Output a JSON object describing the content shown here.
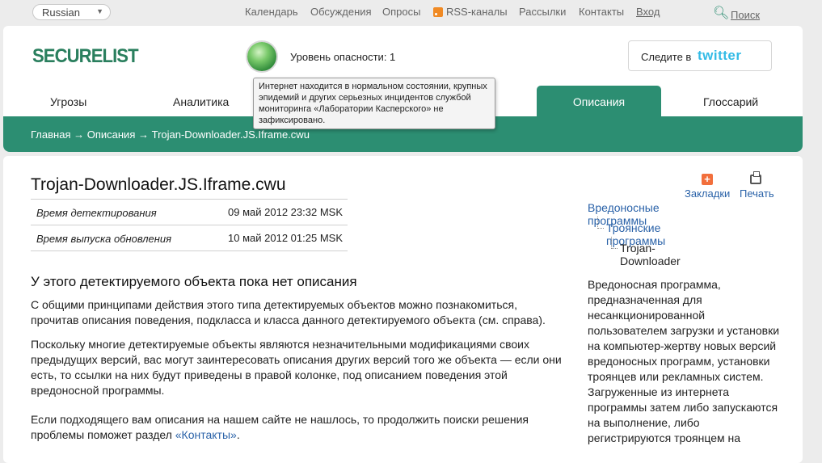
{
  "topbar": {
    "language": "Russian",
    "links": [
      "Календарь",
      "Обсуждения",
      "Опросы",
      "RSS-каналы",
      "Рассылки",
      "Контакты",
      "Вход"
    ],
    "search_label": "Поиск"
  },
  "header": {
    "logo": "SECURELIST",
    "threat_level_label": "Уровень опасности: 1",
    "twitter_prefix": "Следите в",
    "twitter_brand": "twitter",
    "tooltip": "Интернет находится в нормальном состоянии, крупных эпидемий и других серьезных инцидентов службой мониторинга «Лаборатории Касперского» не зафиксировано."
  },
  "nav": {
    "tabs": [
      "Угрозы",
      "Аналитика",
      "Описания",
      "Глоссарий"
    ],
    "active": "Описания"
  },
  "breadcrumb": {
    "home": "Главная",
    "section": "Описания",
    "current": "Trojan-Downloader.JS.Iframe.cwu",
    "separator": "→"
  },
  "main": {
    "title": "Trojan-Downloader.JS.Iframe.cwu",
    "details": [
      {
        "key": "Время детектирования",
        "value": "09 май 2012 23:32 MSK"
      },
      {
        "key": "Время выпуска обновления",
        "value": "10 май 2012 01:25 MSK"
      }
    ],
    "heading": "У этого детектируемого объекта пока нет описания",
    "paragraph1": "С общими принципами действия этого типа детектируемых объектов можно познакомиться, прочитав описания поведения, подкласса и класса данного детектируемого объекта (см. справа).",
    "paragraph2": "Поскольку многие детектируемые объекты являются незначительными модификациями своих предыдущих версий, вас могут заинтересовать описания других версий того же объекта — если они есть, то ссылки на них будут приведены в правой колонке, под описанием поведения этой вредоносной программы.",
    "paragraph3_text": "Если подходящего вам описания на нашем сайте не нашлось, то продолжить поиски решения проблемы поможет раздел ",
    "paragraph3_link": "«Контакты»",
    "paragraph3_end": "."
  },
  "sidebar": {
    "bookmarks_label": "Закладки",
    "print_label": "Печать",
    "tree": [
      "Вредоносные программы",
      "Троянские программы",
      "Trojan-Downloader"
    ],
    "description": "Вредоносная программа, предназначенная для несанкционированной пользователем загрузки и установки на компьютер-жертву новых версий вредоносных программ, установки троянцев или рекламных систем. Загруженные из интернета программы затем либо запускаются на выполнение, либо регистрируются троянцем на"
  },
  "colors": {
    "accent": "#2c8e72",
    "link": "#2a62a8",
    "twitter": "#33bbe6"
  }
}
